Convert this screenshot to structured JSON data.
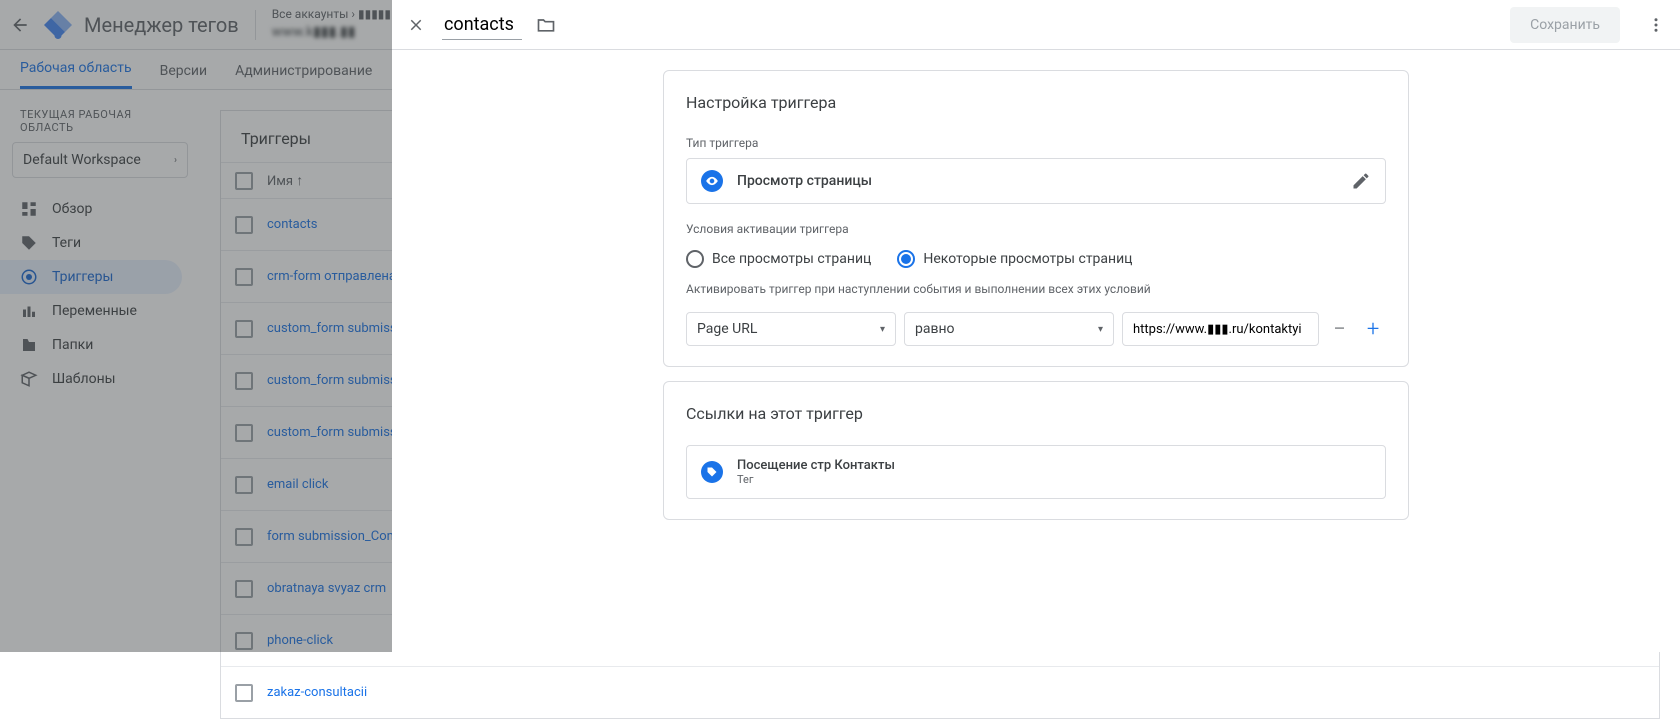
{
  "app_title": "Менеджер тегов",
  "breadcrumb": {
    "all_accounts": "Все аккаунты",
    "account_blur": "▮▮▮▮▮▮▮ р",
    "container_blur": "www.k▮▮▮.▮▮"
  },
  "tabs": {
    "workspace": "Рабочая область",
    "versions": "Версии",
    "admin": "Администрирование"
  },
  "sidebar": {
    "current_ws_label": "ТЕКУЩАЯ РАБОЧАЯ ОБЛАСТЬ",
    "workspace": "Default Workspace",
    "items": [
      {
        "label": "Обзор"
      },
      {
        "label": "Теги"
      },
      {
        "label": "Триггеры"
      },
      {
        "label": "Переменные"
      },
      {
        "label": "Папки"
      },
      {
        "label": "Шаблоны"
      }
    ]
  },
  "list": {
    "title": "Триггеры",
    "name_col": "Имя",
    "rows": [
      "contacts",
      "crm-form отправлена форм",
      "custom_form submission",
      "custom_form submission_K",
      "custom_form submission_Z",
      "email click",
      "form submission_Contacts",
      "obratnaya svyaz crm",
      "phone-click",
      "zakaz-consultacii"
    ]
  },
  "panel": {
    "title_value": "contacts",
    "save": "Сохранить",
    "config_header": "Настройка триггера",
    "type_label": "Тип триггера",
    "type_value": "Просмотр страницы",
    "cond_header": "Условия активации триггера",
    "radio_all": "Все просмотры страниц",
    "radio_some": "Некоторые просмотры страниц",
    "activate_text": "Активировать триггер при наступлении события и выполнении всех этих условий",
    "var_value": "Page URL",
    "op_value": "равно",
    "url_value": "https://www.▮▮▮.ru/kontaktyi",
    "refs_header": "Ссылки на этот триггер",
    "ref_name": "Посещение стр Контакты",
    "ref_sub": "Тег"
  }
}
